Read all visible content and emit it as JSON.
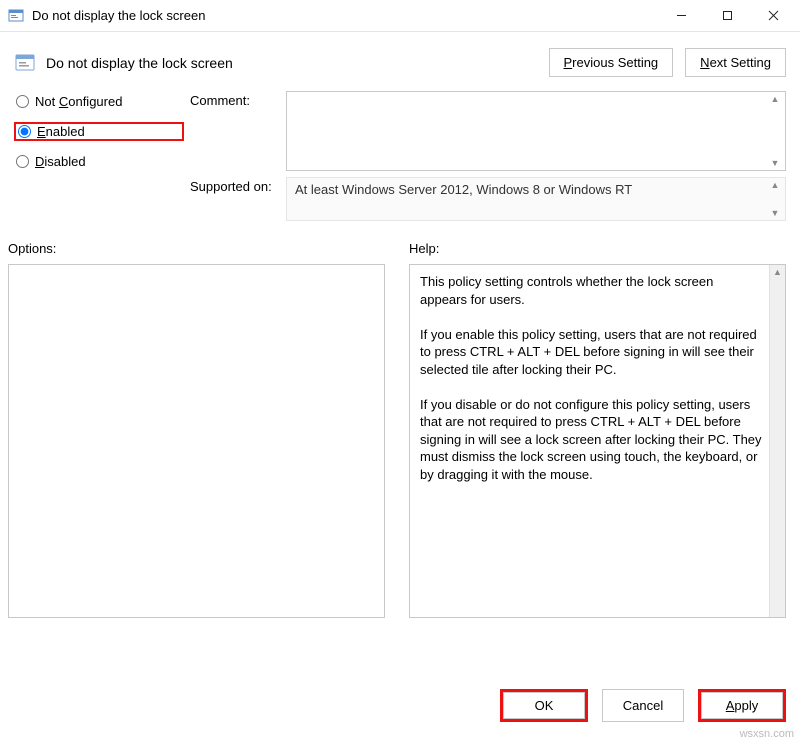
{
  "window": {
    "title": "Do not display the lock screen"
  },
  "header": {
    "setting_title": "Do not display the lock screen",
    "previous_key": "P",
    "previous_rest": "revious Setting",
    "next_key": "N",
    "next_rest": "ext Setting"
  },
  "radios": {
    "not_configured_pre": "Not ",
    "not_configured_key": "C",
    "not_configured_post": "onfigured",
    "enabled_key": "E",
    "enabled_rest": "nabled",
    "disabled_key": "D",
    "disabled_rest": "isabled"
  },
  "labels": {
    "comment": "Comment:",
    "supported_on": "Supported on:",
    "options": "Options:",
    "help": "Help:"
  },
  "supported_text": "At least Windows Server 2012, Windows 8 or Windows RT",
  "help_text": "This policy setting controls whether the lock screen appears for users.\n\nIf you enable this policy setting, users that are not required to press CTRL + ALT + DEL before signing in will see their selected tile after locking their PC.\n\nIf you disable or do not configure this policy setting, users that are not required to press CTRL + ALT + DEL before signing in will see a lock screen after locking their PC. They must dismiss the lock screen using touch, the keyboard, or by dragging it with the mouse.",
  "footer": {
    "ok": "OK",
    "cancel": "Cancel",
    "apply_key": "A",
    "apply_rest": "pply"
  },
  "watermark": "wsxsn.com"
}
